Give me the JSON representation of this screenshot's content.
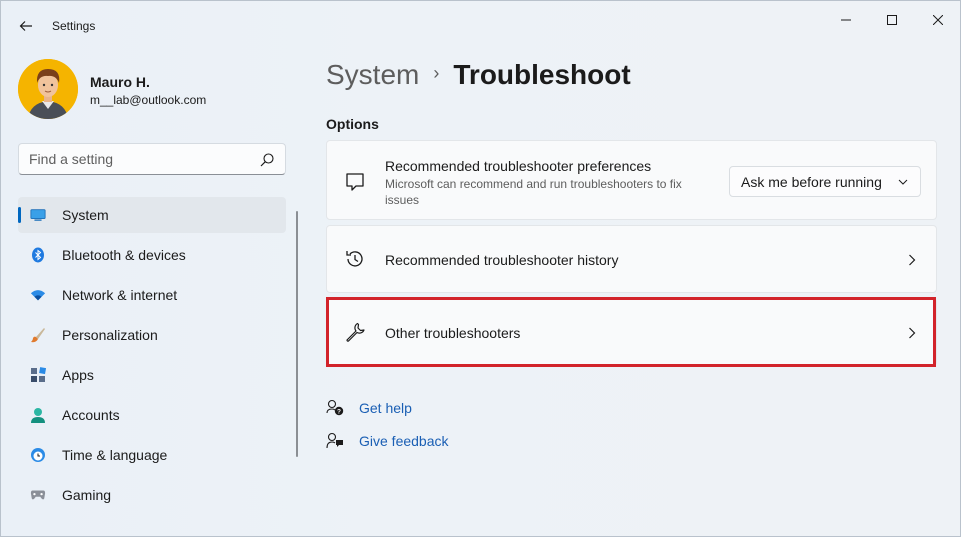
{
  "window": {
    "title": "Settings"
  },
  "user": {
    "name": "Mauro H.",
    "email": "m__lab@outlook.com"
  },
  "search": {
    "placeholder": "Find a setting"
  },
  "sidebar": {
    "items": [
      {
        "label": "System",
        "icon": "system-icon",
        "active": true
      },
      {
        "label": "Bluetooth & devices",
        "icon": "bluetooth-icon"
      },
      {
        "label": "Network & internet",
        "icon": "wifi-icon"
      },
      {
        "label": "Personalization",
        "icon": "brush-icon"
      },
      {
        "label": "Apps",
        "icon": "apps-icon"
      },
      {
        "label": "Accounts",
        "icon": "accounts-icon"
      },
      {
        "label": "Time & language",
        "icon": "globe-clock-icon"
      },
      {
        "label": "Gaming",
        "icon": "gamepad-icon"
      }
    ]
  },
  "breadcrumb": {
    "parent": "System",
    "separator": "›",
    "current": "Troubleshoot"
  },
  "options": {
    "heading": "Options",
    "recommended_prefs": {
      "title": "Recommended troubleshooter preferences",
      "description": "Microsoft can recommend and run troubleshooters to fix issues",
      "dropdown_value": "Ask me before running"
    },
    "history": {
      "title": "Recommended troubleshooter history"
    },
    "other": {
      "title": "Other troubleshooters"
    }
  },
  "links": {
    "get_help": "Get help",
    "give_feedback": "Give feedback"
  },
  "colors": {
    "accent": "#0067c0",
    "highlight": "#d2232a",
    "link": "#1a5fb4"
  }
}
